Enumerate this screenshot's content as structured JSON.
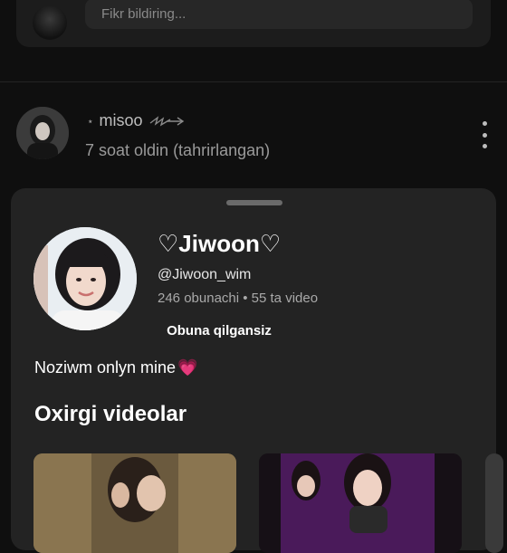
{
  "comment_box": {
    "placeholder": "Fikr bildiring..."
  },
  "post": {
    "author": "misoo",
    "author_decoration": "⋆",
    "time": "7 soat oldin (tahrirlangan)"
  },
  "channel": {
    "name": "♡Jiwoon♡",
    "handle": "@Jiwoon_wim",
    "stats": "246 obunachi • 55 ta video",
    "subscribe_label": "Obuna qilgansiz",
    "description": "Noziwm onlyn mine",
    "description_emoji": "💗"
  },
  "recent_videos": {
    "title": "Oxirgi videolar"
  },
  "colors": {
    "background": "#0f0f0f",
    "sheet": "#232323",
    "card": "#1c1c1c",
    "heart_emoji": "#ff6ad5"
  }
}
